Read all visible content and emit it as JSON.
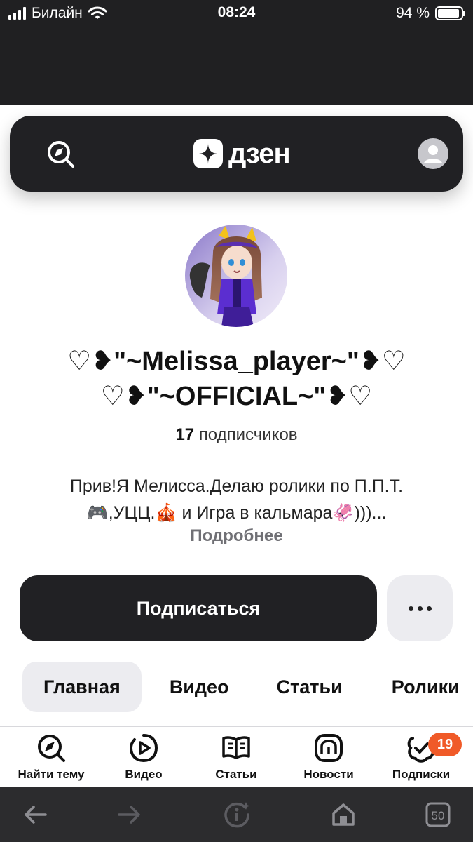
{
  "status_bar": {
    "carrier": "Билайн",
    "time": "08:24",
    "battery_text": "94 %",
    "battery_level": 0.94
  },
  "header": {
    "logo_text": "дзен",
    "icons": {
      "search": "compass-search-icon",
      "avatar": "user-avatar-icon"
    }
  },
  "profile": {
    "name_line1": "♡❥\"~Melissa_player~\"❥♡",
    "name_line2": "♡❥\"~OFFICIAL~\"❥♡",
    "subscriber_count": "17",
    "subscriber_label": "подписчиков",
    "description_line1": "Прив!Я Мелисса.Делаю ролики по П.П.Т.",
    "description_line2": "🎮,УЦЦ.🎪 и Игра в кальмара🦑)))...",
    "more_link": "Подробнее"
  },
  "actions": {
    "subscribe_label": "Подписаться",
    "more_icon": "ellipsis-icon"
  },
  "tabs": [
    {
      "label": "Главная",
      "active": true
    },
    {
      "label": "Видео",
      "active": false
    },
    {
      "label": "Статьи",
      "active": false
    },
    {
      "label": "Ролики",
      "active": false
    }
  ],
  "bottom_nav": [
    {
      "label": "Найти тему",
      "icon": "compass-icon"
    },
    {
      "label": "Видео",
      "icon": "play-icon"
    },
    {
      "label": "Статьи",
      "icon": "book-icon"
    },
    {
      "label": "Новости",
      "icon": "news-icon"
    },
    {
      "label": "Подписки",
      "icon": "subscriptions-icon",
      "badge": "19"
    }
  ],
  "browser_bar": {
    "tab_count": "50",
    "icons": [
      "back-arrow-icon",
      "forward-arrow-icon",
      "assistant-icon",
      "home-icon",
      "tabs-icon"
    ]
  },
  "colors": {
    "dark": "#212124",
    "badge": "#f05a28",
    "muted": "#707075",
    "light_bg": "#ececf0"
  }
}
